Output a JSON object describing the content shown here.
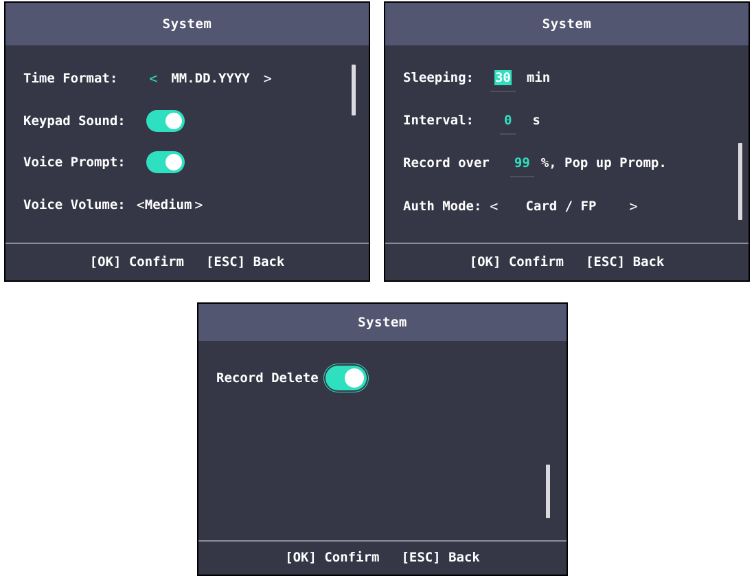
{
  "colors": {
    "accent": "#2ee0c0",
    "background": "#363746",
    "titlebar": "#535671"
  },
  "screen1": {
    "title": "System",
    "time_format_label": "Time Format:",
    "time_format_value": "MM.DD.YYYY",
    "left_arrow": "<",
    "right_arrow": ">",
    "keypad_sound_label": "Keypad Sound:",
    "keypad_sound_on": true,
    "voice_prompt_label": "Voice Prompt:",
    "voice_prompt_on": true,
    "voice_volume_label": "Voice Volume:",
    "voice_volume_value": "Medium",
    "ok_label": "[OK] Confirm",
    "esc_label": "[ESC] Back"
  },
  "screen2": {
    "title": "System",
    "sleeping_label": "Sleeping:",
    "sleeping_value": "30",
    "sleeping_unit": "min",
    "interval_label": "Interval:",
    "interval_value": "0",
    "interval_unit": "s",
    "record_over_label": "Record over",
    "record_over_value": "99",
    "record_over_suffix": "%, Pop up Promp.",
    "auth_mode_label": "Auth Mode:",
    "auth_mode_value": "Card / FP",
    "left_arrow": "<",
    "right_arrow": ">",
    "ok_label": "[OK] Confirm",
    "esc_label": "[ESC] Back"
  },
  "screen3": {
    "title": "System",
    "record_delete_label": "Record Delete",
    "record_delete_on": true,
    "ok_label": "[OK] Confirm",
    "esc_label": "[ESC] Back"
  }
}
